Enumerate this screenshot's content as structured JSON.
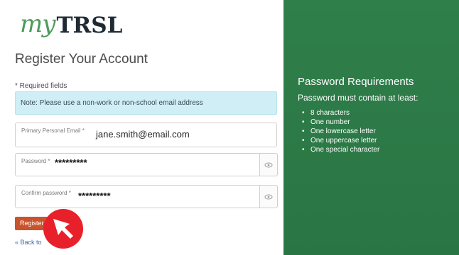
{
  "logo": {
    "my": "my",
    "trsl": "TRSL"
  },
  "page_title": "Register Your Account",
  "required_note": "* Required fields",
  "notice": "Note: Please use a non-work or non-school email address",
  "email_field": {
    "label": "Primary Personal Email *",
    "value": "jane.smith@email.com"
  },
  "password_field": {
    "label": "Password *",
    "value": "*********"
  },
  "confirm_password_field": {
    "label": "Confirm password *",
    "value": "*********"
  },
  "register_button": "Register",
  "back_link": "« Back to",
  "requirements": {
    "title": "Password Requirements",
    "subtitle": "Password must contain at least:",
    "items": [
      "8 characters",
      "One number",
      "One lowercase letter",
      "One uppercase letter",
      "One special character"
    ]
  },
  "colors": {
    "brand_green": "#2d7a48",
    "logo_green": "#4f9a5a",
    "button_orange": "#c9532d",
    "notice_bg": "#cfeef6",
    "cursor_red": "#e8202a"
  },
  "icons": [
    "eye-icon",
    "cursor-arrow-icon"
  ]
}
